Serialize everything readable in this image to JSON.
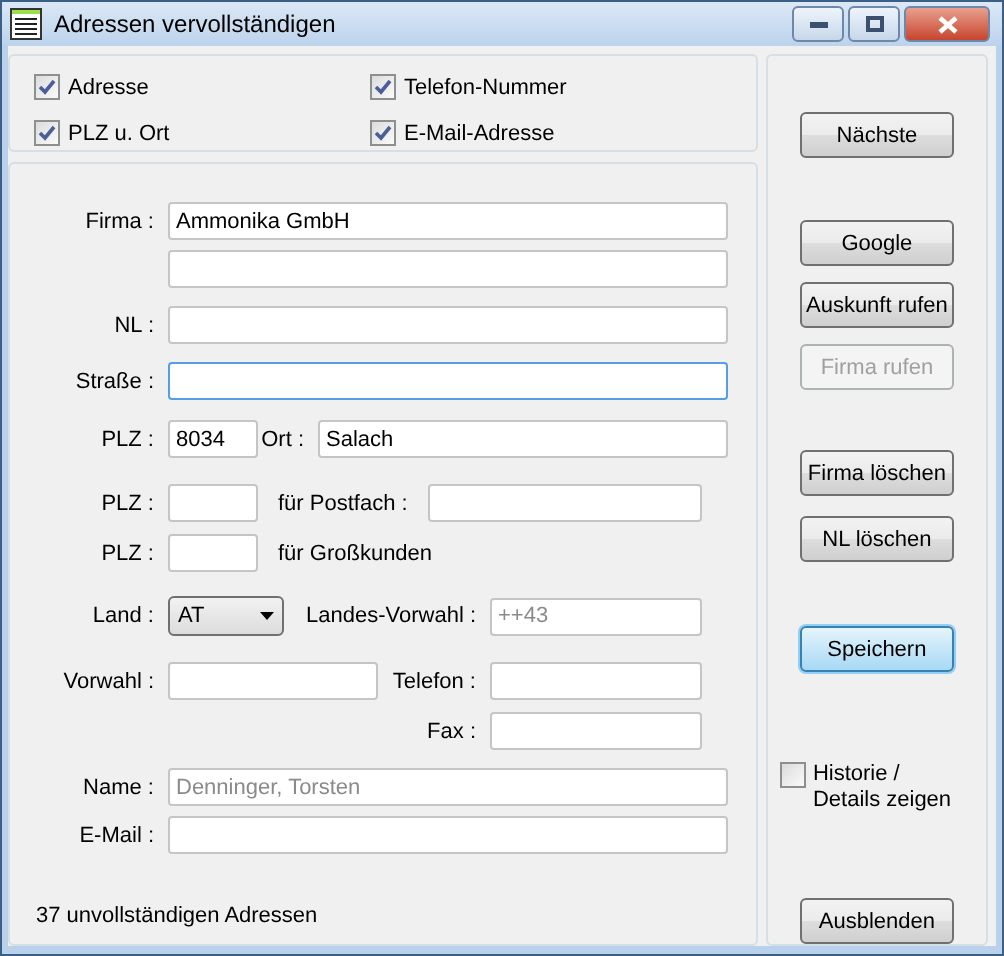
{
  "window": {
    "title": "Adressen vervollständigen"
  },
  "filters": [
    {
      "label": "Adresse",
      "checked": true
    },
    {
      "label": "Telefon-Nummer",
      "checked": true
    },
    {
      "label": "PLZ u. Ort",
      "checked": true
    },
    {
      "label": "E-Mail-Adresse",
      "checked": true
    }
  ],
  "form": {
    "lines": [
      {
        "items": [
          {
            "kind": "label",
            "text": "Firma :"
          },
          {
            "kind": "field",
            "value": "Ammonika GmbH",
            "focused": false
          }
        ]
      },
      {
        "items": [
          {
            "kind": "field",
            "focused": false
          }
        ]
      },
      {
        "items": [
          {
            "kind": "label",
            "text": "NL :"
          },
          {
            "kind": "field",
            "focused": false
          }
        ]
      },
      {
        "items": [
          {
            "kind": "label",
            "text": "Straße :"
          },
          {
            "kind": "field",
            "focused": true
          }
        ]
      },
      {
        "items": [
          {
            "kind": "label",
            "text": "PLZ :"
          },
          {
            "kind": "field",
            "value": "8034",
            "focused": false
          },
          {
            "kind": "label",
            "text": "Ort :"
          },
          {
            "kind": "field",
            "value": "Salach",
            "focused": false
          }
        ]
      },
      {
        "items": [
          {
            "kind": "label",
            "text": "PLZ :"
          },
          {
            "kind": "field",
            "focused": false
          },
          {
            "kind": "label",
            "text": "für Postfach :"
          },
          {
            "kind": "field",
            "focused": false
          }
        ]
      },
      {
        "items": [
          {
            "kind": "label",
            "text": "PLZ :"
          },
          {
            "kind": "field",
            "focused": false
          },
          {
            "kind": "label",
            "text": "für Großkunden"
          }
        ]
      },
      {
        "items": [
          {
            "kind": "label",
            "text": "Land :"
          },
          {
            "kind": "combo",
            "value": "AT"
          },
          {
            "kind": "label",
            "text": "Landes-Vorwahl :"
          },
          {
            "kind": "field",
            "placeholder": "++43",
            "focused": false
          }
        ]
      },
      {
        "items": [
          {
            "kind": "label",
            "text": "Vorwahl :"
          },
          {
            "kind": "field",
            "focused": false
          },
          {
            "kind": "label",
            "text": "Telefon :"
          },
          {
            "kind": "field",
            "focused": false
          }
        ]
      },
      {
        "items": [
          {
            "kind": "label",
            "text": "Fax :"
          },
          {
            "kind": "field",
            "focused": false
          }
        ]
      },
      {
        "items": [
          {
            "kind": "label",
            "text": "Name :"
          },
          {
            "kind": "field",
            "placeholder": "Denninger, Torsten",
            "focused": false
          }
        ]
      },
      {
        "items": [
          {
            "kind": "label",
            "text": "E-Mail :"
          },
          {
            "kind": "field",
            "focused": false
          }
        ]
      }
    ],
    "status": "37 unvollständigen Adressen"
  },
  "actions": [
    {
      "kind": "button",
      "label": "Nächste",
      "disabled": false,
      "default": false
    },
    {
      "kind": "button",
      "label": "Google",
      "disabled": false,
      "default": false
    },
    {
      "kind": "button",
      "label": "Auskunft rufen",
      "disabled": false,
      "default": false
    },
    {
      "kind": "button",
      "label": "Firma rufen",
      "disabled": true,
      "default": false
    },
    {
      "kind": "button",
      "label": "Firma löschen",
      "disabled": false,
      "default": false
    },
    {
      "kind": "button",
      "label": "NL löschen",
      "disabled": false,
      "default": false
    },
    {
      "kind": "button",
      "label": "Speichern",
      "disabled": false,
      "default": true
    },
    {
      "kind": "checkbox",
      "label": "Historie / Details zeigen",
      "checked": false
    },
    {
      "kind": "button",
      "label": "Ausblenden",
      "disabled": false,
      "default": false
    }
  ]
}
